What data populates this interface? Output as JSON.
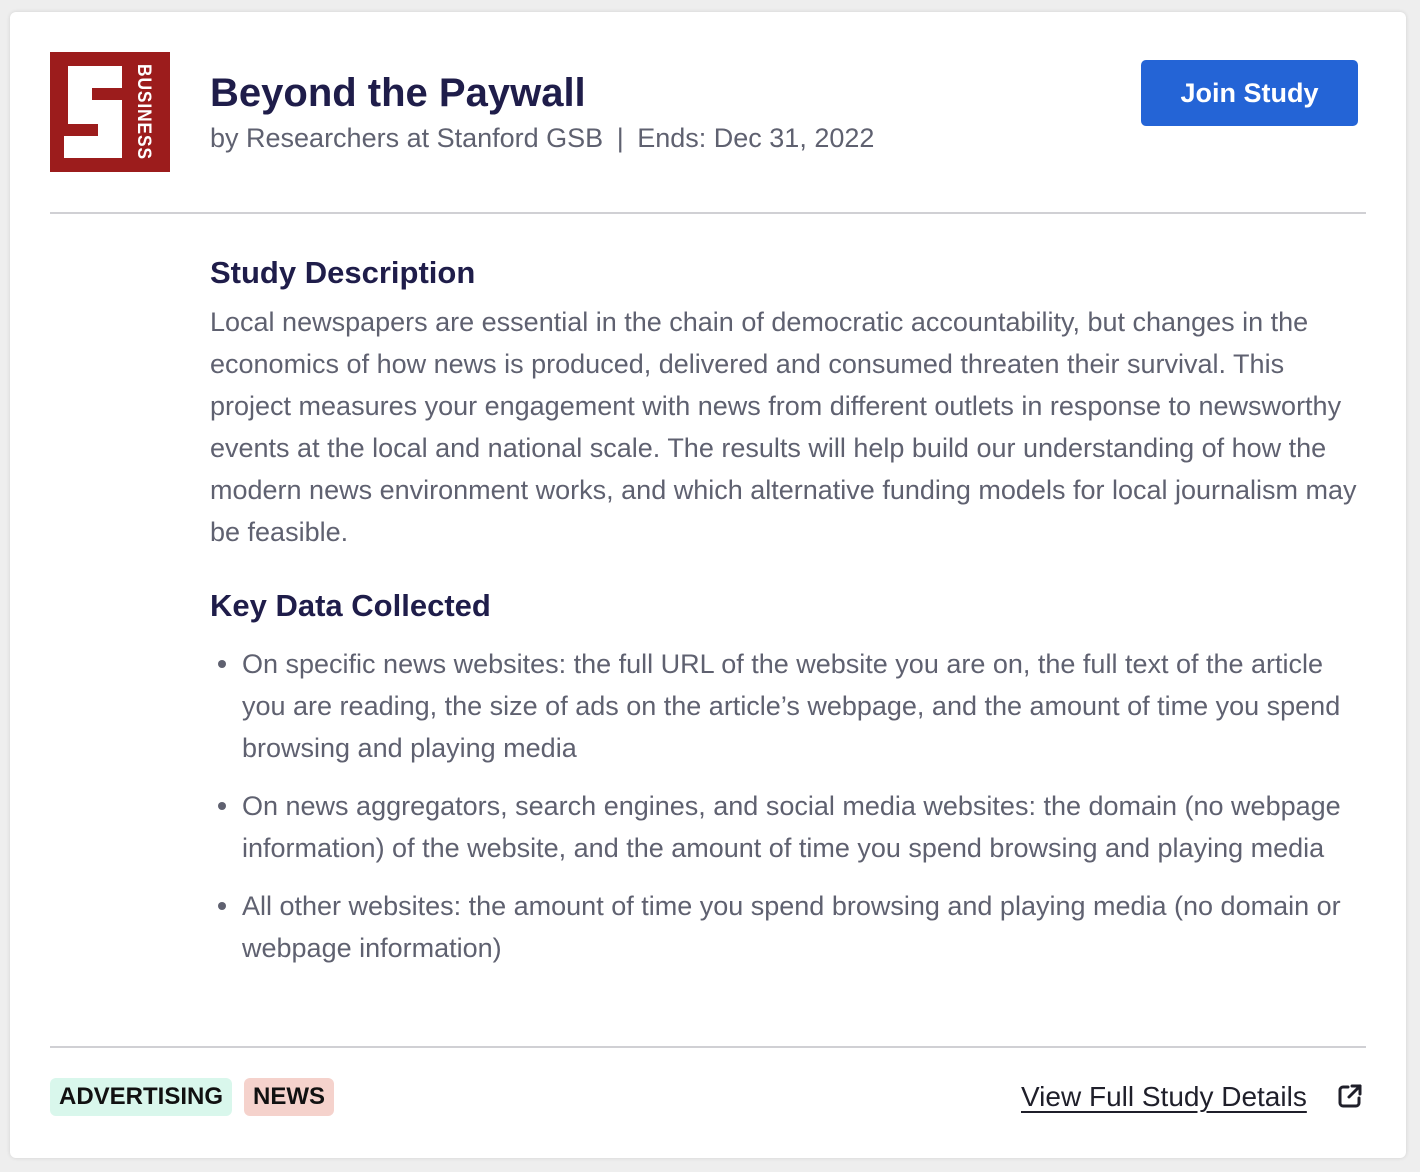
{
  "study": {
    "logo_text": "BUSINESS",
    "title": "Beyond the Paywall",
    "author": "by Researchers at Stanford GSB",
    "separator": "|",
    "ends": "Ends: Dec 31, 2022",
    "join_label": "Join Study"
  },
  "description": {
    "heading": "Study Description",
    "text": "Local newspapers are essential in the chain of democratic accountability, but changes in the economics of how news is produced, delivered and consumed threaten their survival. This project measures your engagement with news from different outlets in response to newsworthy events at the local and national scale. The results will help build our understanding of how the modern news environment works, and which alternative funding models for local journalism may be feasible."
  },
  "key_data": {
    "heading": "Key Data Collected",
    "items": [
      "On specific news websites: the full URL of the website you are on, the full text of the article you are reading, the size of ads on the article’s webpage, and the amount of time you spend browsing and playing media",
      "On news aggregators, search engines, and social media websites: the domain (no webpage information) of the website, and the amount of time you spend browsing and playing media",
      "All other websites: the amount of time you spend browsing and playing media (no domain or webpage information)"
    ]
  },
  "footer": {
    "tags": [
      {
        "label": "ADVERTISING",
        "color": "#d9f7ec"
      },
      {
        "label": "NEWS",
        "color": "#f5d2cc"
      }
    ],
    "details_link": "View Full Study Details",
    "details_icon": "external-link-icon"
  },
  "colors": {
    "brand_red": "#9c1c1c",
    "accent_blue": "#2464d6",
    "heading": "#1f1d4a",
    "body_text": "#5f6170"
  }
}
